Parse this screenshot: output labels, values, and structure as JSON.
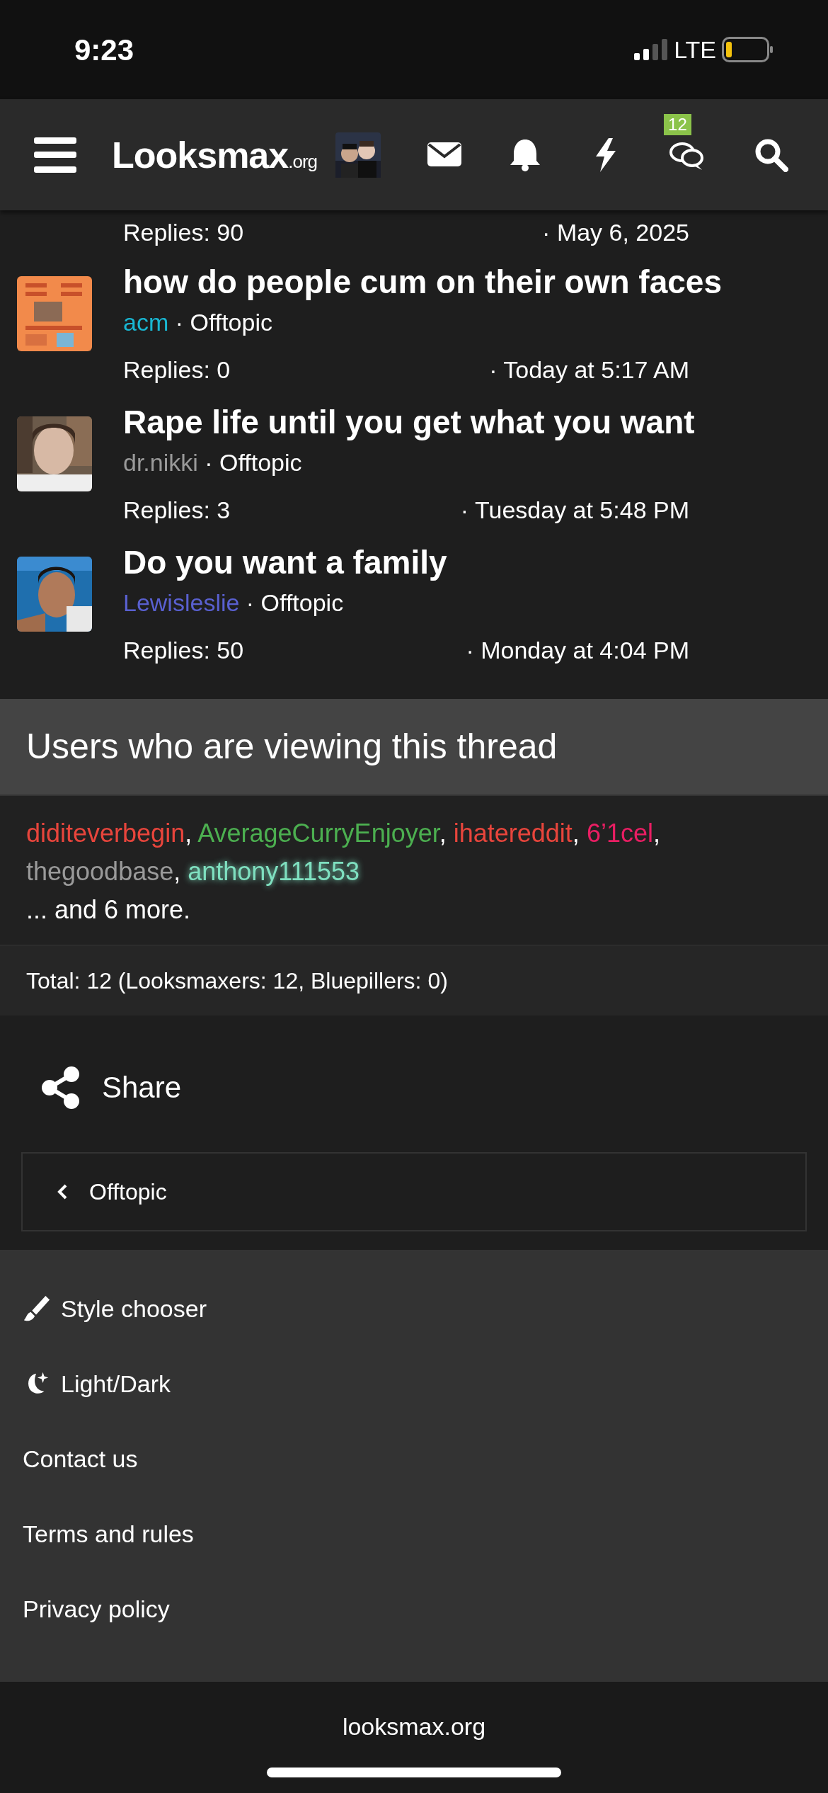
{
  "status_bar": {
    "time": "9:23",
    "network": "LTE"
  },
  "header": {
    "logo": "Looksmax",
    "logo_suffix": ".org",
    "chat_badge": "12"
  },
  "threads": [
    {
      "replies": "Replies: 90",
      "date": "· May 6, 2025"
    },
    {
      "title": "how do people cum on their own faces",
      "author": {
        "name": "acm",
        "color": "#19b6d2"
      },
      "forum": "· Offtopic",
      "replies": "Replies: 0",
      "date": "· Today at 5:17 AM"
    },
    {
      "title": "Rape life until you get what you want",
      "author": {
        "name": "dr.nikki",
        "color": "#9a9a9a"
      },
      "forum": "· Offtopic",
      "replies": "Replies: 3",
      "date": "· Tuesday at 5:48 PM"
    },
    {
      "title": "Do you want a family",
      "author": {
        "name": "Lewisleslie",
        "color": "#5960d0"
      },
      "forum": "· Offtopic",
      "replies": "Replies: 50",
      "date": "· Monday at 4:04 PM"
    }
  ],
  "viewers": {
    "title": "Users who are viewing this thread",
    "users": [
      {
        "name": "diditeverbegin",
        "color": "#e8453c",
        "glow": false,
        "separator": ","
      },
      {
        "name": "AverageCurryEnjoyer",
        "color": "#4caf50",
        "glow": false,
        "separator": ","
      },
      {
        "name": "ihatereddit",
        "color": "#e8453c",
        "glow": false,
        "separator": ","
      },
      {
        "name": "6’1cel",
        "color": "#e91e63",
        "glow": false,
        "separator": ","
      },
      {
        "name": "thegoodbase",
        "color": "#9a9a9a",
        "glow": false,
        "separator": ","
      },
      {
        "name": "anthony111553",
        "color": "#7fe0c0",
        "glow": true
      }
    ],
    "more": "... and 6 more.",
    "total": "Total: 12 (Looksmaxers: 12, Bluepillers: 0)"
  },
  "share": "Share",
  "breadcrumb": "Offtopic",
  "footer_links": [
    "Style chooser",
    "Light/Dark",
    "Contact us",
    "Terms and rules",
    "Privacy policy"
  ],
  "bottom_bar": {
    "url": "looksmax.org"
  }
}
